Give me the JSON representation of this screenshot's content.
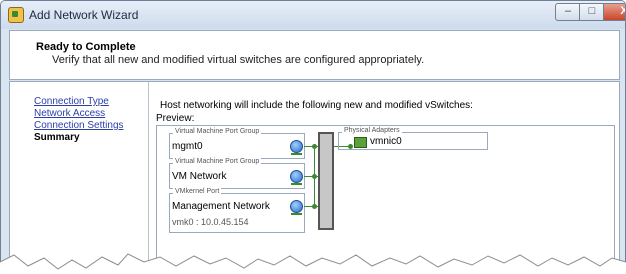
{
  "window": {
    "title": "Add Network Wizard",
    "buttons": {
      "minimize": "–",
      "maximize": "□",
      "close": "X"
    }
  },
  "header": {
    "title": "Ready to Complete",
    "subtitle": "Verify that all new and modified virtual switches are configured appropriately."
  },
  "nav": {
    "items": [
      {
        "label": "Connection Type",
        "current": false
      },
      {
        "label": "Network Access",
        "current": false
      },
      {
        "label": "Connection Settings",
        "current": false
      },
      {
        "label": "Summary",
        "current": true
      }
    ]
  },
  "content": {
    "intro": "Host networking will include the following new and modified vSwitches:",
    "preview_label": "Preview:"
  },
  "preview": {
    "port_groups": [
      {
        "type": "Virtual Machine Port Group",
        "name": "mgmt0",
        "detail": ""
      },
      {
        "type": "Virtual Machine Port Group",
        "name": "VM Network",
        "detail": ""
      },
      {
        "type": "VMkernel Port",
        "name": "Management Network",
        "detail": "vmk0 : 10.0.45.154"
      }
    ],
    "physical_adapters": {
      "legend": "Physical Adapters",
      "adapters": [
        "vmnic0"
      ]
    }
  },
  "colors": {
    "link": "#2b3fa8",
    "connector": "#3c8a2e",
    "titlebar": "#cddbee"
  }
}
